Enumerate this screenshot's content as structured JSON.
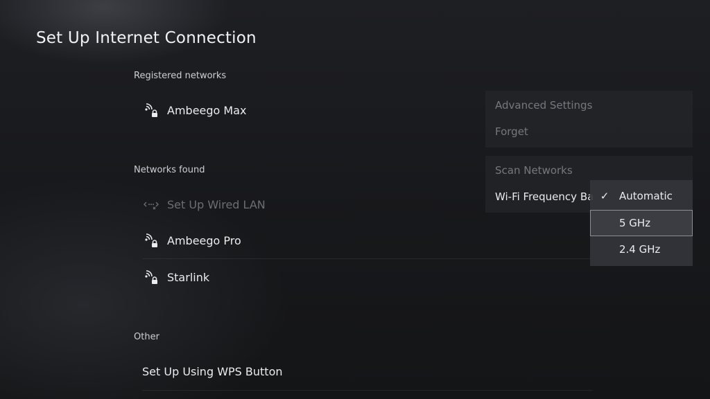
{
  "header": {
    "title": "Set Up Internet Connection"
  },
  "registered": {
    "heading": "Registered networks",
    "items": [
      {
        "label": "Ambeego Max",
        "icon": "wifi-locked-icon"
      }
    ]
  },
  "found": {
    "heading": "Networks found",
    "items": [
      {
        "label": "Set Up Wired LAN",
        "icon": "wired-lan-icon",
        "disabled": true
      },
      {
        "label": "Ambeego Pro",
        "icon": "wifi-locked-icon"
      },
      {
        "label": "Starlink",
        "icon": "wifi-locked-icon"
      }
    ]
  },
  "other": {
    "heading": "Other",
    "items": [
      {
        "label": "Set Up Using WPS Button"
      }
    ]
  },
  "options_menu": {
    "group1": [
      "Advanced Settings",
      "Forget"
    ],
    "group2": [
      "Scan Networks",
      "Wi-Fi Frequency Ba"
    ]
  },
  "frequency_dropdown": {
    "selected": "Automatic",
    "focused": "5 GHz",
    "options": [
      "Automatic",
      "5 GHz",
      "2.4 GHz"
    ],
    "check_glyph": "✓"
  },
  "colors": {
    "background": "#18191c",
    "text": "#ececef",
    "disabled_text": "#6d6e73",
    "panel": "#2a2b30"
  }
}
